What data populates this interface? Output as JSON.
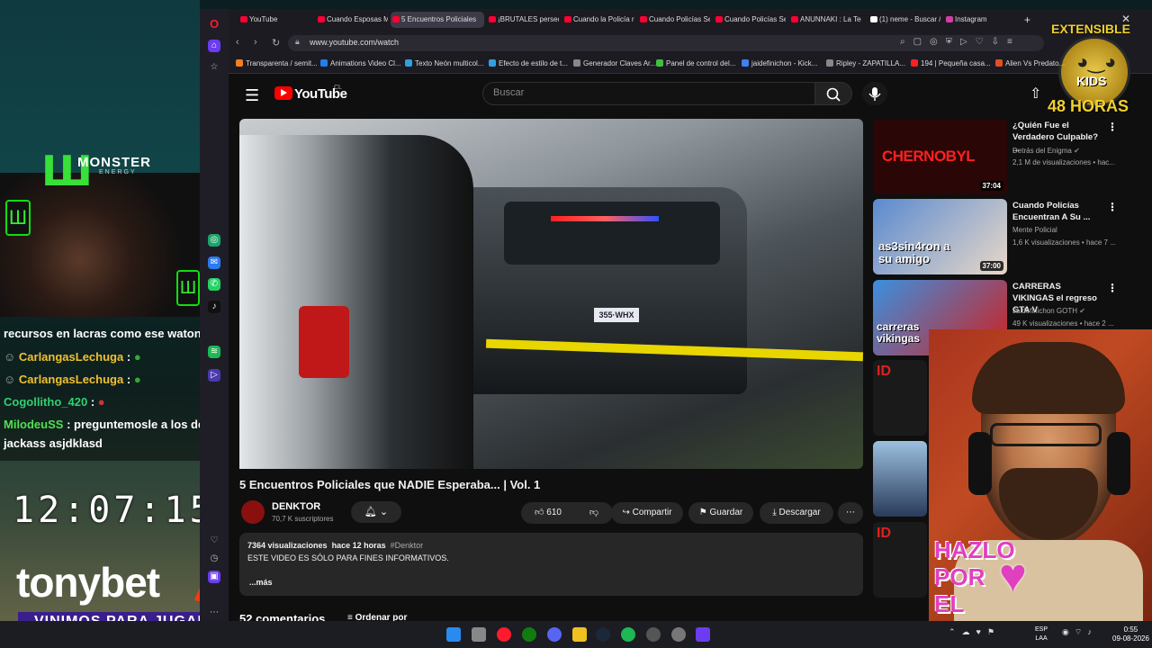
{
  "stream": {
    "sponsor_brand": "MONSTER",
    "sponsor_sub": "ENERGY",
    "chat": [
      {
        "name": "",
        "msg": "recursos en lacras como ese waton"
      },
      {
        "name": "CarlangasLechuga",
        "msg": ":"
      },
      {
        "name": "CarlangasLechuga",
        "msg": ":"
      },
      {
        "name": "Cogollitho_420",
        "msg": ":"
      },
      {
        "name": "MilodeuSS",
        "msg": ": preguntemosle a los de"
      },
      {
        "name": "",
        "msg": "jackass asjdklasd"
      }
    ],
    "clock": "12:07:15",
    "tonybet": "tonybet",
    "banner": "VINIMOS PARA JUGAR",
    "extensible_title": "EXTENSIBLE",
    "extensible_kids": "KIDS",
    "extensible_hours": "48 HORAS",
    "hazlo": "HAZLO\nPOR\nEL"
  },
  "browser": {
    "tabs": [
      {
        "label": "YouTube",
        "active": false
      },
      {
        "label": "Cuando Esposas M",
        "active": false
      },
      {
        "label": "5 Encuentros Policiales",
        "active": true
      },
      {
        "label": "¡BRUTALES persecu",
        "active": false
      },
      {
        "label": "Cuando la Policía re",
        "active": false
      },
      {
        "label": "Cuando Policías Se",
        "active": false
      },
      {
        "label": "Cuando Policías Se",
        "active": false
      },
      {
        "label": "ANUNNAKI : La Tec",
        "active": false
      },
      {
        "label": "(1) neme - Buscar /",
        "active": false
      },
      {
        "label": "Instagram",
        "active": false
      }
    ],
    "url": "www.youtube.com/watch",
    "bookmarks": [
      {
        "label": "Transparenta / semit...",
        "color": "#f08020"
      },
      {
        "label": "Animations Video Cl...",
        "color": "#2080f0"
      },
      {
        "label": "Texto Neón multicol...",
        "color": "#30a0e0"
      },
      {
        "label": "Efecto de estilo de t...",
        "color": "#30a0e0"
      },
      {
        "label": "Generador Claves Ar...",
        "color": "#888888"
      },
      {
        "label": "Panel de control del...",
        "color": "#40c040"
      },
      {
        "label": "jaidefinichon - Kick...",
        "color": "#4080f0"
      },
      {
        "label": "Ripley - ZAPATILLA...",
        "color": "#888888"
      },
      {
        "label": "194 | Pequeña casa...",
        "color": "#ff2020"
      },
      {
        "label": "Alien Vs Predato...",
        "color": "#e05020"
      }
    ]
  },
  "youtube": {
    "logo": "YouTube",
    "logo_cc": "CL",
    "search_placeholder": "Buscar",
    "video": {
      "plate": "355·WHX",
      "title": "5 Encuentros Policiales que NADIE Esperaba... | Vol. 1",
      "channel": "DENKTOR",
      "subscribers": "70,7 K suscriptores",
      "likes": "610",
      "share": "Compartir",
      "save": "Guardar",
      "download": "Descargar",
      "views": "7364 visualizaciones",
      "age": "hace 12 horas",
      "hashtag": "#Denktor",
      "description": "ESTE VIDEO ES SÓLO PARA FINES INFORMATIVOS.",
      "more": "...más",
      "comments_count": "52 comentarios",
      "sort": "Ordenar por"
    },
    "recommendations": [
      {
        "title": "¿Quién Fue el Verdadero Culpable? ...",
        "channel": "Detrás del Enigma",
        "stats": "2,1 M de visualizaciones • hac...",
        "duration": "37:04",
        "thumb_text": "CHERNOBYL",
        "thumb_color": "#3a0a0a"
      },
      {
        "title": "Cuando Policías Encuentran A Su ...",
        "channel": "Mente Policial",
        "stats": "1,6 K visualizaciones • hace 7 ...",
        "duration": "37:00",
        "thumb_text": "as3sin4ron a su amigo",
        "thumb_color": "#3a6ab0"
      },
      {
        "title": "CARRERAS VIKINGAS el regreso GTA V",
        "channel": "Jaidefinichon GOTH",
        "stats": "49 K visualizaciones • hace 2 ...",
        "duration": "",
        "thumb_text": "carreras vikingas",
        "thumb_color": "#2a80d0"
      }
    ]
  },
  "taskbar": {
    "lang": "ESP\nLAA",
    "time": "0:55",
    "date": "09-08-2026"
  }
}
